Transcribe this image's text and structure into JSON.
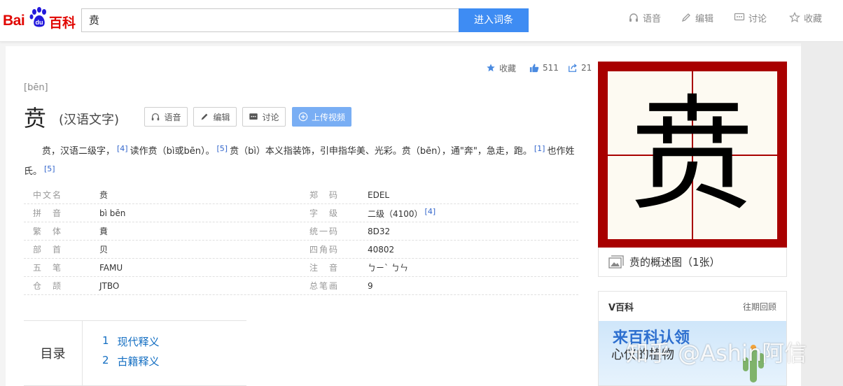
{
  "header": {
    "logo_text_left": "Bai",
    "logo_text_paw": "du",
    "logo_text_right": "百科",
    "search_value": "贲",
    "search_button": "进入词条",
    "nav": [
      {
        "label": "语音",
        "icon": "headphones-icon"
      },
      {
        "label": "编辑",
        "icon": "pencil-icon"
      },
      {
        "label": "讨论",
        "icon": "chat-icon"
      },
      {
        "label": "收藏",
        "icon": "star-icon"
      }
    ]
  },
  "toolbar": {
    "favorite": "收藏",
    "likes": "511",
    "shares": "21"
  },
  "entry": {
    "pinyin": "[bēn]",
    "title": "贲",
    "subtitle": "(汉语文字)",
    "buttons": {
      "voice": "语音",
      "edit": "编辑",
      "discuss": "讨论",
      "upload": "上传视频"
    },
    "summary": {
      "p1": "贲，汉语二级字，",
      "ref1": "[4]",
      "p2": "读作贲（bì或bēn）。",
      "ref2": "[5]",
      "p3": "贲（bì）本义指装饰，引申指华美、光彩。贲（bēn），通\"奔\"，急走，跑。",
      "ref3": "[1]",
      "p4": "也作姓氏。",
      "ref4": "[5]"
    }
  },
  "basic_info": [
    {
      "k1": "中文名",
      "v1": "贲",
      "k2": "郑　码",
      "v2": "EDEL",
      "ref2": ""
    },
    {
      "k1": "拼　音",
      "v1": "bì bēn",
      "k2": "字　级",
      "v2": "二级（4100）",
      "ref2": "[4]"
    },
    {
      "k1": "繁　体",
      "v1": "賁",
      "k2": "统一码",
      "v2": "8D32",
      "ref2": ""
    },
    {
      "k1": "部　首",
      "v1": "贝",
      "k2": "四角码",
      "v2": "40802",
      "ref2": ""
    },
    {
      "k1": "五　笔",
      "v1": "FAMU",
      "k2": "注　音",
      "v2": "ㄅㄧˋ ㄅㄣ",
      "ref2": ""
    },
    {
      "k1": "仓　颉",
      "v1": "JTBO",
      "k2": "总笔画",
      "v2": "9",
      "ref2": ""
    }
  ],
  "catalog": {
    "title": "目录",
    "items": [
      {
        "num": "1",
        "label": "现代释义"
      },
      {
        "num": "2",
        "label": "古籍释义"
      }
    ]
  },
  "side": {
    "char_glyph": "贲",
    "caption": "贲的概述图（1张）",
    "vbaike_title": "V百科",
    "vbaike_more": "往期回顾",
    "banner_title": "来百科认领",
    "banner_sub": "心仪的植物"
  },
  "watermark": "知乎 @Ashin阿信"
}
